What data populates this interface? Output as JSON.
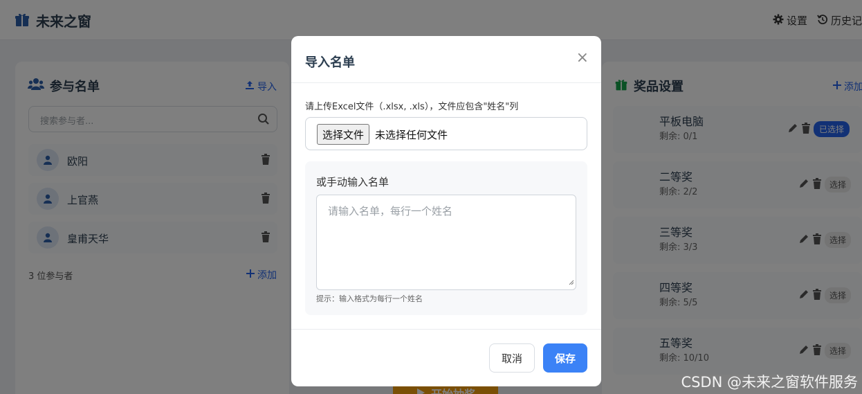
{
  "app": {
    "title": "未来之窗",
    "settings_label": "设置",
    "history_label": "历史记"
  },
  "participants": {
    "title": "参与名单",
    "import_label": "导入",
    "search_placeholder": "搜索参与者...",
    "items": [
      {
        "name": "欧阳"
      },
      {
        "name": "上官燕"
      },
      {
        "name": "皇甫天华"
      }
    ],
    "count_label": "3 位参与者",
    "add_label": "添加"
  },
  "prizes": {
    "title": "奖品设置",
    "add_label": "添加",
    "items": [
      {
        "name": "平板电脑",
        "remaining": "剩余: 0/1",
        "action": "已选择",
        "selected": true
      },
      {
        "name": "二等奖",
        "remaining": "剩余: 2/2",
        "action": "选择",
        "selected": false
      },
      {
        "name": "三等奖",
        "remaining": "剩余: 3/3",
        "action": "选择",
        "selected": false
      },
      {
        "name": "四等奖",
        "remaining": "剩余: 5/5",
        "action": "选择",
        "selected": false
      },
      {
        "name": "五等奖",
        "remaining": "剩余: 10/10",
        "action": "选择",
        "selected": false
      }
    ]
  },
  "start_button": {
    "label": "开始抽奖"
  },
  "modal": {
    "title": "导入名单",
    "close_symbol": "×",
    "upload_hint": "请上传Excel文件（.xlsx, .xls），文件应包含\"姓名\"列",
    "file_button_label": "选择文件",
    "file_status": "未选择任何文件",
    "manual_label": "或手动输入名单",
    "manual_placeholder": "请输入名单，每行一个姓名",
    "manual_tip": "提示：输入格式为每行一个姓名",
    "cancel_label": "取消",
    "save_label": "保存"
  },
  "watermark": "CSDN @未来之窗软件服务",
  "colors": {
    "accent": "#2563eb",
    "primary_button": "#3b82f6",
    "brand_icon": "#2c5fa8",
    "prize_icon": "#16a34a",
    "start_button": "#f59e0b",
    "overlay": "rgba(0,0,0,0.5)"
  },
  "icons": {
    "brand": "gift-icon",
    "settings": "gear-icon",
    "history": "history-icon",
    "participants": "users-icon",
    "import": "upload-icon",
    "search": "search-icon",
    "avatar": "user-icon",
    "delete": "trash-icon",
    "add": "plus-icon",
    "prizes": "gift-icon",
    "edit": "pencil-icon",
    "start": "play-icon"
  }
}
